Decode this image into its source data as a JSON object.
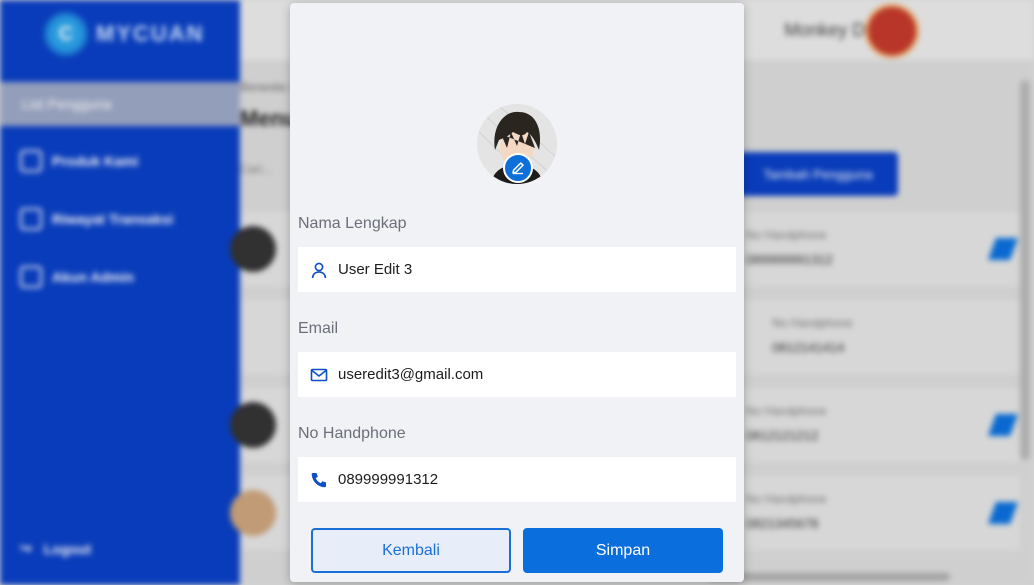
{
  "app": {
    "logo_mark": "C",
    "logo_text": "MYCUAN"
  },
  "sidebar": {
    "active_label": "List Pengguna",
    "items": [
      {
        "label": "Produk Kami",
        "icon": "calendar-icon"
      },
      {
        "label": "Riwayat Transaksi",
        "icon": "history-icon"
      },
      {
        "label": "Akun Admin",
        "icon": "users-icon"
      }
    ],
    "logout_label": "Logout"
  },
  "topbar": {
    "user_name": "Monkey D. Luffy"
  },
  "main": {
    "breadcrumb": "Beranda / Pengguna",
    "title": "Menu Pengguna",
    "search_placeholder": "Cari...",
    "add_button": "Tambah Pengguna",
    "rows": [
      {
        "label": "No Handphone",
        "phone": "089999991312"
      },
      {
        "label": "No Handphone",
        "phone": "0812141414"
      },
      {
        "label": "No Handphone",
        "phone": "0812121212"
      },
      {
        "label": "No Handphone",
        "phone": "0821345678"
      }
    ]
  },
  "modal": {
    "fields": {
      "name": {
        "label": "Nama Lengkap",
        "value": "User Edit 3",
        "icon": "user-icon"
      },
      "email": {
        "label": "Email",
        "value": "useredit3@gmail.com",
        "icon": "mail-icon"
      },
      "phone": {
        "label": "No Handphone",
        "value": "089999991312",
        "icon": "phone-icon"
      }
    },
    "back_button": "Kembali",
    "save_button": "Simpan"
  },
  "colors": {
    "primary": "#0a6fdc",
    "sidebar": "#0a3fc2",
    "modal_bg": "#f1f2f6"
  }
}
